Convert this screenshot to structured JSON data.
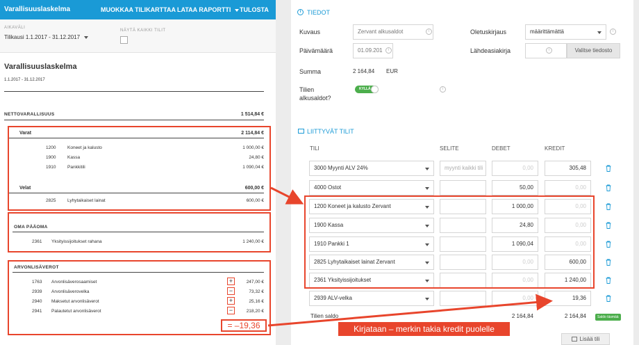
{
  "topbar": {
    "title": "Varallisuuslaskelma",
    "edit_chart": "MUOKKAA TILIKARTTAA",
    "download": "LATAA RAPORTTI",
    "print": "TULOSTA"
  },
  "filters": {
    "period_label": "AIKAVÄLI",
    "period_value": "Tilikausi 1.1.2017 - 31.12.2017",
    "show_all_label": "NÄYTÄ KAIKKI TILIT"
  },
  "report": {
    "title": "Varallisuuslaskelma",
    "date_range": "1.1.2017 - 31.12.2017",
    "net_label": "NETTOVARALLISUUS",
    "net_value": "1 514,84 €",
    "assets_label": "Varat",
    "assets_total": "2 114,84 €",
    "assets": [
      {
        "code": "1200",
        "name": "Koneet ja kalusto",
        "value": "1 000,00 €"
      },
      {
        "code": "1900",
        "name": "Kassa",
        "value": "24,80 €"
      },
      {
        "code": "1910",
        "name": "Pankkitili",
        "value": "1 090,04 €"
      }
    ],
    "liabilities_label": "Velat",
    "liabilities_total": "600,00 €",
    "liabilities": [
      {
        "code": "2825",
        "name": "Lyhytaikaiset lainat",
        "value": "600,00 €"
      }
    ],
    "equity_label": "OMA PÄÄOMA",
    "equity": [
      {
        "code": "2361",
        "name": "Yksityissijoitukset rahana",
        "value": "1 240,00 €"
      }
    ],
    "vat_label": "ARVONLISÄVEROT",
    "vat": [
      {
        "code": "1763",
        "name": "Arvonlisäverosaamiset",
        "sign": "+",
        "value": "247,00 €"
      },
      {
        "code": "2939",
        "name": "Arvonlisäverovelka",
        "sign": "−",
        "value": "73,32 €"
      },
      {
        "code": "2940",
        "name": "Maksetut arvonlisäverot",
        "sign": "+",
        "value": "25,16 €"
      },
      {
        "code": "2941",
        "name": "Palautetut arvonlisäverot",
        "sign": "−",
        "value": "218,20 €"
      }
    ],
    "vat_result": "= –19,36"
  },
  "info": {
    "section_title": "TIEDOT",
    "desc_label": "Kuvaus",
    "desc_value": "Zervant alkusaldot",
    "date_label": "Päivämäärä",
    "date_value": "01.09.201",
    "sum_label": "Summa",
    "sum_value": "2 164,84",
    "sum_currency": "EUR",
    "opening_label_1": "Tilien",
    "opening_label_2": "alkusaldot?",
    "toggle_label": "KYLLÄ",
    "default_label": "Oletuskirjaus",
    "default_value": "määrittämättä",
    "source_label": "Lähdeasiakirja",
    "choose_file": "Valitse tiedosto"
  },
  "accounts": {
    "section_title": "LIITTYVÄT TILIT",
    "col_account": "TILI",
    "col_desc": "SELITE",
    "col_debit": "DEBET",
    "col_credit": "KREDIT",
    "rows": [
      {
        "account": "3000 Myynti ALV 24%",
        "desc": "",
        "desc_placeholder": "myynti kaikki tili",
        "debit": "",
        "credit": "305,48"
      },
      {
        "account": "4000 Ostot",
        "desc": "",
        "desc_placeholder": "",
        "debit": "50,00",
        "credit": ""
      },
      {
        "account": "1200 Koneet ja kalusto Zervant",
        "desc": "",
        "desc_placeholder": "",
        "debit": "1 000,00",
        "credit": ""
      },
      {
        "account": "1900 Kassa",
        "desc": "",
        "desc_placeholder": "",
        "debit": "24,80",
        "credit": ""
      },
      {
        "account": "1910 Pankki 1",
        "desc": "",
        "desc_placeholder": "",
        "debit": "1 090,04",
        "credit": ""
      },
      {
        "account": "2825 Lyhytaikaiset lainat Zervant",
        "desc": "",
        "desc_placeholder": "",
        "debit": "",
        "credit": "600,00"
      },
      {
        "account": "2361 Yksityissijoitukset",
        "desc": "",
        "desc_placeholder": "",
        "debit": "",
        "credit": "1 240,00"
      },
      {
        "account": "2939 ALV-velka",
        "desc": "",
        "desc_placeholder": "",
        "debit": "",
        "credit": "19,36"
      }
    ],
    "empty_placeholder": "0,00",
    "balance_label": "Tilien saldo",
    "balance_debit": "2 164,84",
    "balance_credit": "2 164,84",
    "balance_badge": "Saldo täsmää",
    "add_row": "Lisää tili"
  },
  "annotation": {
    "callout": "Kirjataan – merkin takia kredit puolelle"
  },
  "colors": {
    "brand": "#1a9ad6",
    "annotation": "#e8452c",
    "success": "#4cae4c"
  }
}
